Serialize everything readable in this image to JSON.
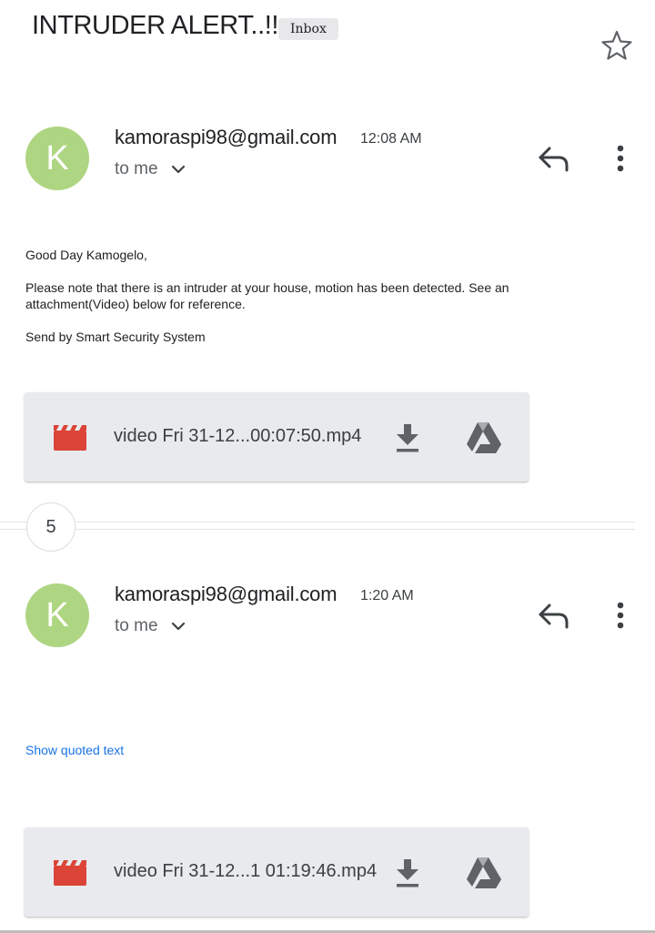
{
  "header": {
    "subject": "INTRUDER ALERT..!!",
    "label": "Inbox",
    "star_icon": "star-outline-icon"
  },
  "collapsed": {
    "count": "5"
  },
  "messages": [
    {
      "avatar_letter": "K",
      "avatar_color": "#aed581",
      "sender": "kamoraspi98@gmail.com",
      "time": "12:08 AM",
      "recipient": "to me",
      "body": {
        "greeting": "Good Day Kamogelo,",
        "paragraph_line1": "Please note that there is an intruder at your house, motion has been detected. See an",
        "paragraph_line2": "attachment(Video) below for reference.",
        "signoff": "Send by Smart Security System"
      },
      "attachment": {
        "file_icon": "video-clapperboard-icon",
        "file_icon_color": "#db4437",
        "name": "video Fri 31-12...00:07:50.mp4"
      }
    },
    {
      "avatar_letter": "K",
      "avatar_color": "#aed581",
      "sender": "kamoraspi98@gmail.com",
      "time": "1:20 AM",
      "recipient": "to me",
      "show_quoted": "Show quoted text",
      "attachment": {
        "file_icon": "video-clapperboard-icon",
        "file_icon_color": "#db4437",
        "name": "video Fri 31-12...1 01:19:46.mp4"
      }
    }
  ]
}
